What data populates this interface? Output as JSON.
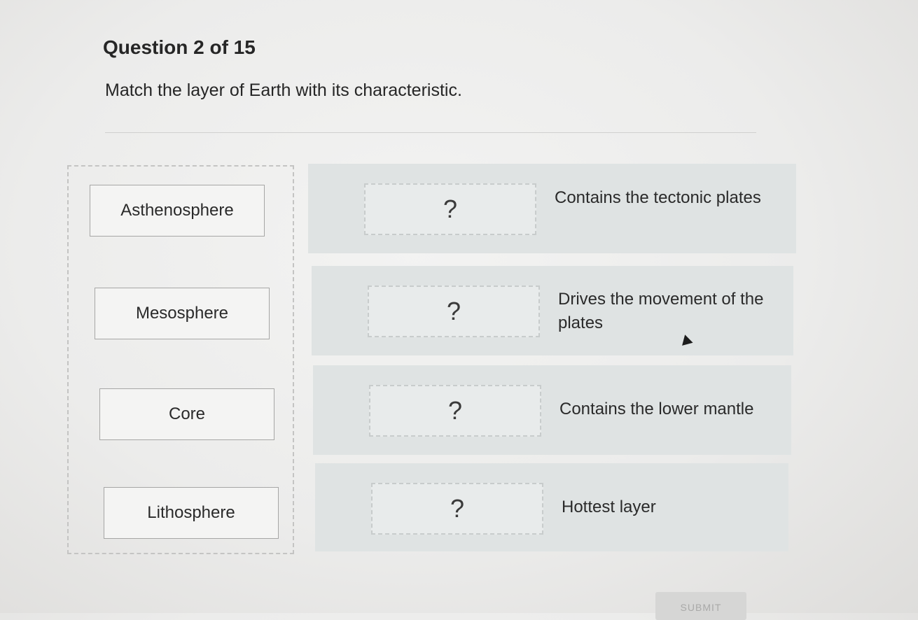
{
  "question": {
    "header": "Question 2 of 15",
    "prompt": "Match the layer of Earth with its characteristic."
  },
  "answer_bank": {
    "items": [
      {
        "label": "Asthenosphere"
      },
      {
        "label": "Mesosphere"
      },
      {
        "label": "Core"
      },
      {
        "label": "Lithosphere"
      }
    ]
  },
  "match_rows": [
    {
      "placeholder": "?",
      "characteristic": "Contains the tectonic plates"
    },
    {
      "placeholder": "?",
      "characteristic": "Drives the movement of the plates"
    },
    {
      "placeholder": "?",
      "characteristic": "Contains the lower mantle"
    },
    {
      "placeholder": "?",
      "characteristic": "Hottest layer"
    }
  ],
  "submit": {
    "label": "SUBMIT"
  },
  "colors": {
    "row_background": "#dfe3e3",
    "tile_border": "#a6a6a5",
    "submit_disabled": "#d6d6d5"
  }
}
